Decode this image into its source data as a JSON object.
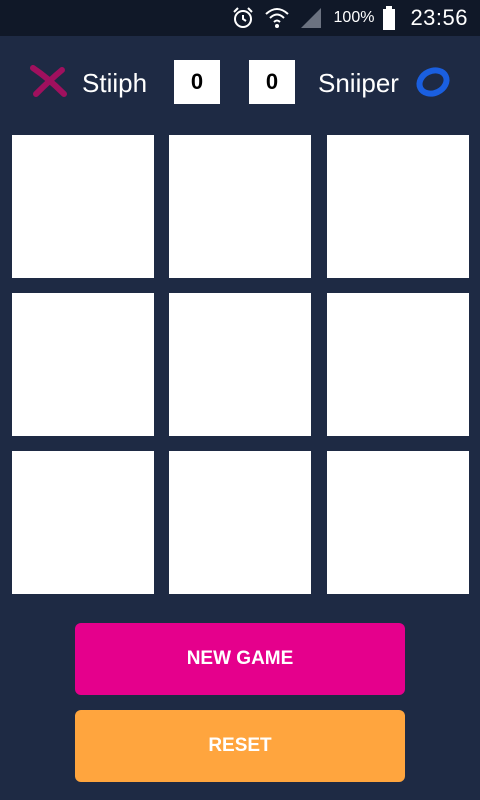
{
  "status_bar": {
    "icons": [
      "alarm-icon",
      "wifi-icon",
      "signal-icon",
      "battery-icon"
    ],
    "battery": "100%",
    "time": "23:56"
  },
  "players": {
    "player1": {
      "name": "Stiiph",
      "score": "0",
      "symbol_icon": "x-mark-icon",
      "color": "#a0105e"
    },
    "player2": {
      "name": "Sniiper",
      "score": "0",
      "symbol_icon": "o-mark-icon",
      "color": "#1a5fe0"
    }
  },
  "board": {
    "rows": 3,
    "cols": 3,
    "cells": [
      "",
      "",
      "",
      "",
      "",
      "",
      "",
      "",
      ""
    ]
  },
  "buttons": {
    "new_game": "NEW GAME",
    "reset": "RESET"
  },
  "colors": {
    "background": "#1e2a44",
    "new_game": "#e5008c",
    "reset": "#ffa53e"
  }
}
